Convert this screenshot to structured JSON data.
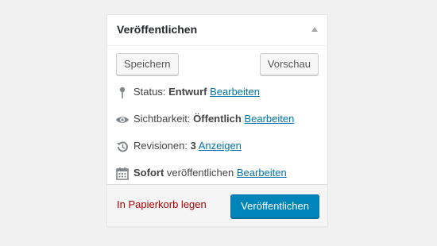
{
  "box": {
    "title": "Veröffentlichen"
  },
  "actions": {
    "save_label": "Speichern",
    "preview_label": "Vorschau"
  },
  "status": {
    "label": "Status:",
    "value": "Entwurf",
    "edit_link": "Bearbeiten",
    "icon": "pin-icon"
  },
  "visibility": {
    "label": "Sichtbarkeit:",
    "value": "Öffentlich",
    "edit_link": "Bearbeiten",
    "icon": "eye-icon"
  },
  "revisions": {
    "label": "Revisionen:",
    "count": "3",
    "link": "Anzeigen",
    "icon": "history-icon"
  },
  "schedule": {
    "value": "Sofort",
    "label": "veröffentlichen",
    "edit_link": "Bearbeiten",
    "icon": "calendar-icon"
  },
  "footer": {
    "trash_label": "In Papierkorb legen",
    "publish_label": "Veröffentlichen"
  },
  "colors": {
    "link": "#0073aa",
    "delete": "#aa0000",
    "primary_button": "#0085ba"
  }
}
